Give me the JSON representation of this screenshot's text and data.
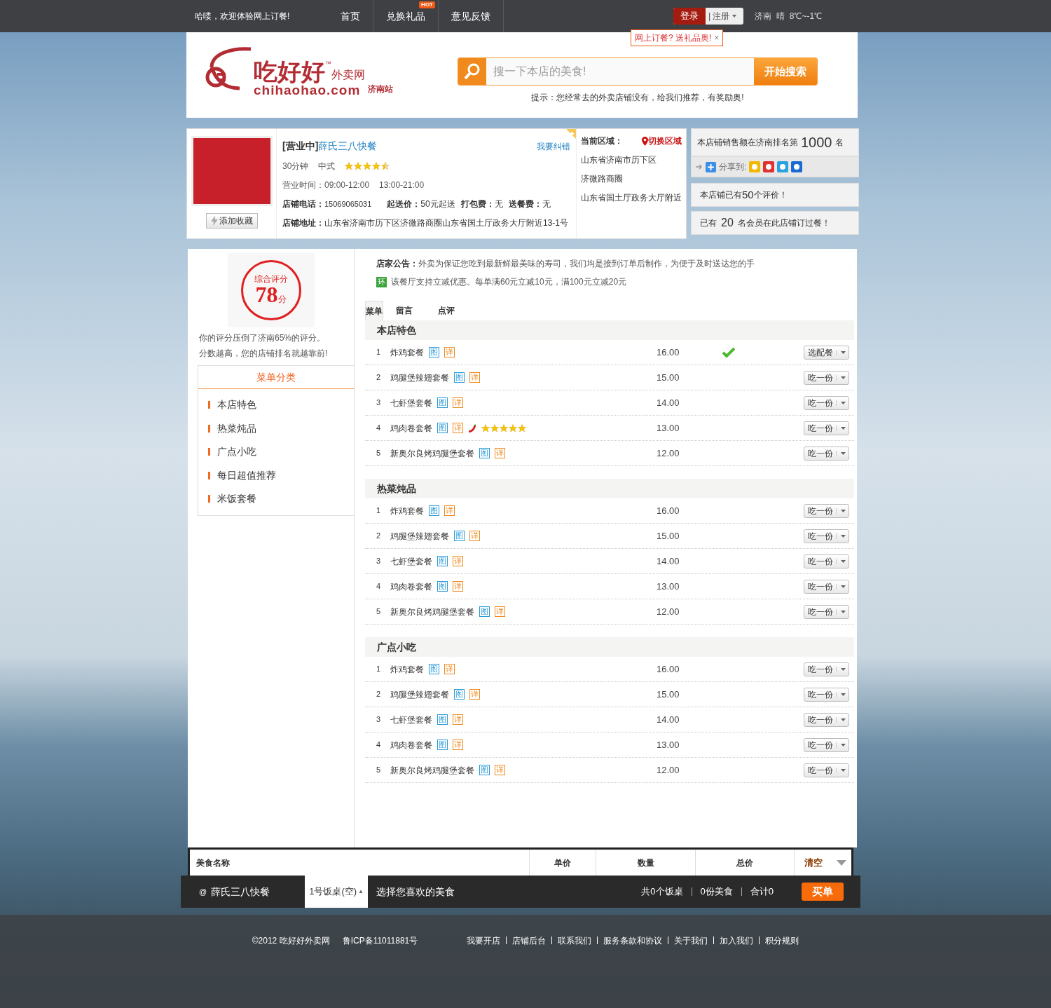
{
  "topbar": {
    "greeting": "哈喽，欢迎体验网上订餐!",
    "nav": [
      {
        "label": "首页"
      },
      {
        "label": "兑换礼品",
        "badge": "HOT"
      },
      {
        "label": "意见反馈"
      }
    ],
    "login": "登录",
    "register": "| 注册",
    "weather": "济南  晴  8℃~-1℃"
  },
  "promo_tip": {
    "text": "网上订餐? 送礼品奥!",
    "close": "×"
  },
  "logo": {
    "name": "吃好好",
    "tm": "™",
    "suffix": "外卖网",
    "domain": "chihaohao.com",
    "city": "济南站"
  },
  "search": {
    "placeholder": "搜一下本店的美食!",
    "button": "开始搜索",
    "hint": "提示：您经常去的外卖店铺没有，给我们推荐，有奖励奥!"
  },
  "shop": {
    "status": "[营业中]",
    "name": "薛氏三八快餐",
    "report": "我要纠错",
    "delivery_time": "30分钟",
    "cuisine": "中式",
    "stars": 4.5,
    "hours_label": "营业时间：",
    "hours": [
      "09:00-12:00",
      "13:00-21:00"
    ],
    "fields": [
      {
        "label": "店铺电话：",
        "value": "15069065031"
      },
      {
        "label": "起送价：",
        "value": "50元起送"
      },
      {
        "label": "打包费：",
        "value": "无"
      },
      {
        "label": "送餐费：",
        "value": "无"
      }
    ],
    "address_label": "店铺地址：",
    "address": "山东省济南市历下区济微路商圈山东省国土厅政务大厅附近13-1号",
    "favorite": "添加收藏"
  },
  "area": {
    "label": "当前区域：",
    "switch": "切换区域",
    "lines": [
      "山东省济南市历下区",
      "济微路商圈",
      "山东省国土厅政务大厅附近"
    ]
  },
  "stats": {
    "rank": [
      "本店铺销售额在济南排名第",
      "1000",
      "名"
    ],
    "share": "分享到:",
    "reviews": [
      "本店铺已有",
      "50",
      "个评价！"
    ],
    "members": [
      "已有",
      "20",
      "名会员在此店铺订过餐！"
    ]
  },
  "score": {
    "label": "综合评分",
    "value": "78",
    "unit": "分",
    "lines": [
      "你的评分压倒了济南65%的评分。",
      "分数越高，您的店铺排名就越靠前!"
    ]
  },
  "categories": {
    "title": "菜单分类",
    "items": [
      "本店特色",
      "热菜炖品",
      "广点小吃",
      "每日超值推荐",
      "米饭套餐"
    ]
  },
  "notice": {
    "label": "店家公告：",
    "text": "外卖为保证您吃到最新鲜最美味的寿司，我们均是接到订单后制作，为便于及时送达您的手",
    "promo_badge": "环",
    "promo_text": "该餐厅支持立减优惠。每单满60元立减10元，满100元立减20元"
  },
  "tabs": [
    {
      "label": "菜单",
      "selected": true
    },
    {
      "label": "留言",
      "selected": false
    },
    {
      "label": "点评",
      "selected": false
    }
  ],
  "sections": [
    {
      "title": "本店特色",
      "items": [
        {
          "num": "1",
          "name": "炸鸡套餐",
          "tags": [
            "图",
            "详"
          ],
          "spicy": false,
          "price": "16.00",
          "checked": true,
          "button": "选配餐"
        },
        {
          "num": "2",
          "name": "鸡腿堡辣翅套餐",
          "tags": [
            "图",
            "详"
          ],
          "spicy": false,
          "price": "15.00",
          "checked": false,
          "button": "吃一份"
        },
        {
          "num": "3",
          "name": "七虾堡套餐",
          "tags": [
            "图",
            "详"
          ],
          "spicy": false,
          "price": "14.00",
          "checked": false,
          "button": "吃一份"
        },
        {
          "num": "4",
          "name": "鸡肉卷套餐",
          "tags": [
            "图",
            "详"
          ],
          "spicy": true,
          "stars": 5,
          "price": "13.00",
          "checked": false,
          "button": "吃一份"
        },
        {
          "num": "5",
          "name": "新奥尔良烤鸡腿堡套餐",
          "tags": [
            "图",
            "详"
          ],
          "spicy": false,
          "price": "12.00",
          "checked": false,
          "button": "吃一份"
        }
      ]
    },
    {
      "title": "热菜炖品",
      "items": [
        {
          "num": "1",
          "name": "炸鸡套餐",
          "tags": [
            "图",
            "详"
          ],
          "spicy": false,
          "price": "16.00",
          "checked": false,
          "button": "吃一份"
        },
        {
          "num": "2",
          "name": "鸡腿堡辣翅套餐",
          "tags": [
            "图",
            "详"
          ],
          "spicy": false,
          "price": "15.00",
          "checked": false,
          "button": "吃一份"
        },
        {
          "num": "3",
          "name": "七虾堡套餐",
          "tags": [
            "图",
            "详"
          ],
          "spicy": false,
          "price": "14.00",
          "checked": false,
          "button": "吃一份"
        },
        {
          "num": "4",
          "name": "鸡肉卷套餐",
          "tags": [
            "图",
            "详"
          ],
          "spicy": false,
          "price": "13.00",
          "checked": false,
          "button": "吃一份"
        },
        {
          "num": "5",
          "name": "新奥尔良烤鸡腿堡套餐",
          "tags": [
            "图",
            "详"
          ],
          "spicy": false,
          "price": "12.00",
          "checked": false,
          "button": "吃一份"
        }
      ]
    },
    {
      "title": "广点小吃",
      "items": [
        {
          "num": "1",
          "name": "炸鸡套餐",
          "tags": [
            "图",
            "详"
          ],
          "spicy": false,
          "price": "16.00",
          "checked": false,
          "button": "吃一份"
        },
        {
          "num": "2",
          "name": "鸡腿堡辣翅套餐",
          "tags": [
            "图",
            "详"
          ],
          "spicy": false,
          "price": "15.00",
          "checked": false,
          "button": "吃一份"
        },
        {
          "num": "3",
          "name": "七虾堡套餐",
          "tags": [
            "图",
            "详"
          ],
          "spicy": false,
          "price": "14.00",
          "checked": false,
          "button": "吃一份"
        },
        {
          "num": "4",
          "name": "鸡肉卷套餐",
          "tags": [
            "图",
            "详"
          ],
          "spicy": false,
          "price": "13.00",
          "checked": false,
          "button": "吃一份"
        },
        {
          "num": "5",
          "name": "新奥尔良烤鸡腿堡套餐",
          "tags": [
            "图",
            "详"
          ],
          "spicy": false,
          "price": "12.00",
          "checked": false,
          "button": "吃一份"
        }
      ]
    }
  ],
  "cart": {
    "columns": [
      "美食名称",
      "单价",
      "数量",
      "总价"
    ],
    "clear": "清空",
    "shop_mark": "@",
    "shop": "薛氏三八快餐",
    "table": "1号饭桌(空)",
    "table_caret": "▲",
    "prompt": "选择您喜欢的美食",
    "summary": [
      "共0个饭桌",
      "0份美食",
      "合计0"
    ],
    "checkout": "买单"
  },
  "footer": {
    "copyright": "©2012 吃好好外卖网",
    "icp": "鲁ICP备11011881号",
    "links": [
      "我要开店",
      "店铺后台",
      "联系我们",
      "服务条款和协议",
      "关于我们",
      "加入我们",
      "积分规则"
    ]
  }
}
